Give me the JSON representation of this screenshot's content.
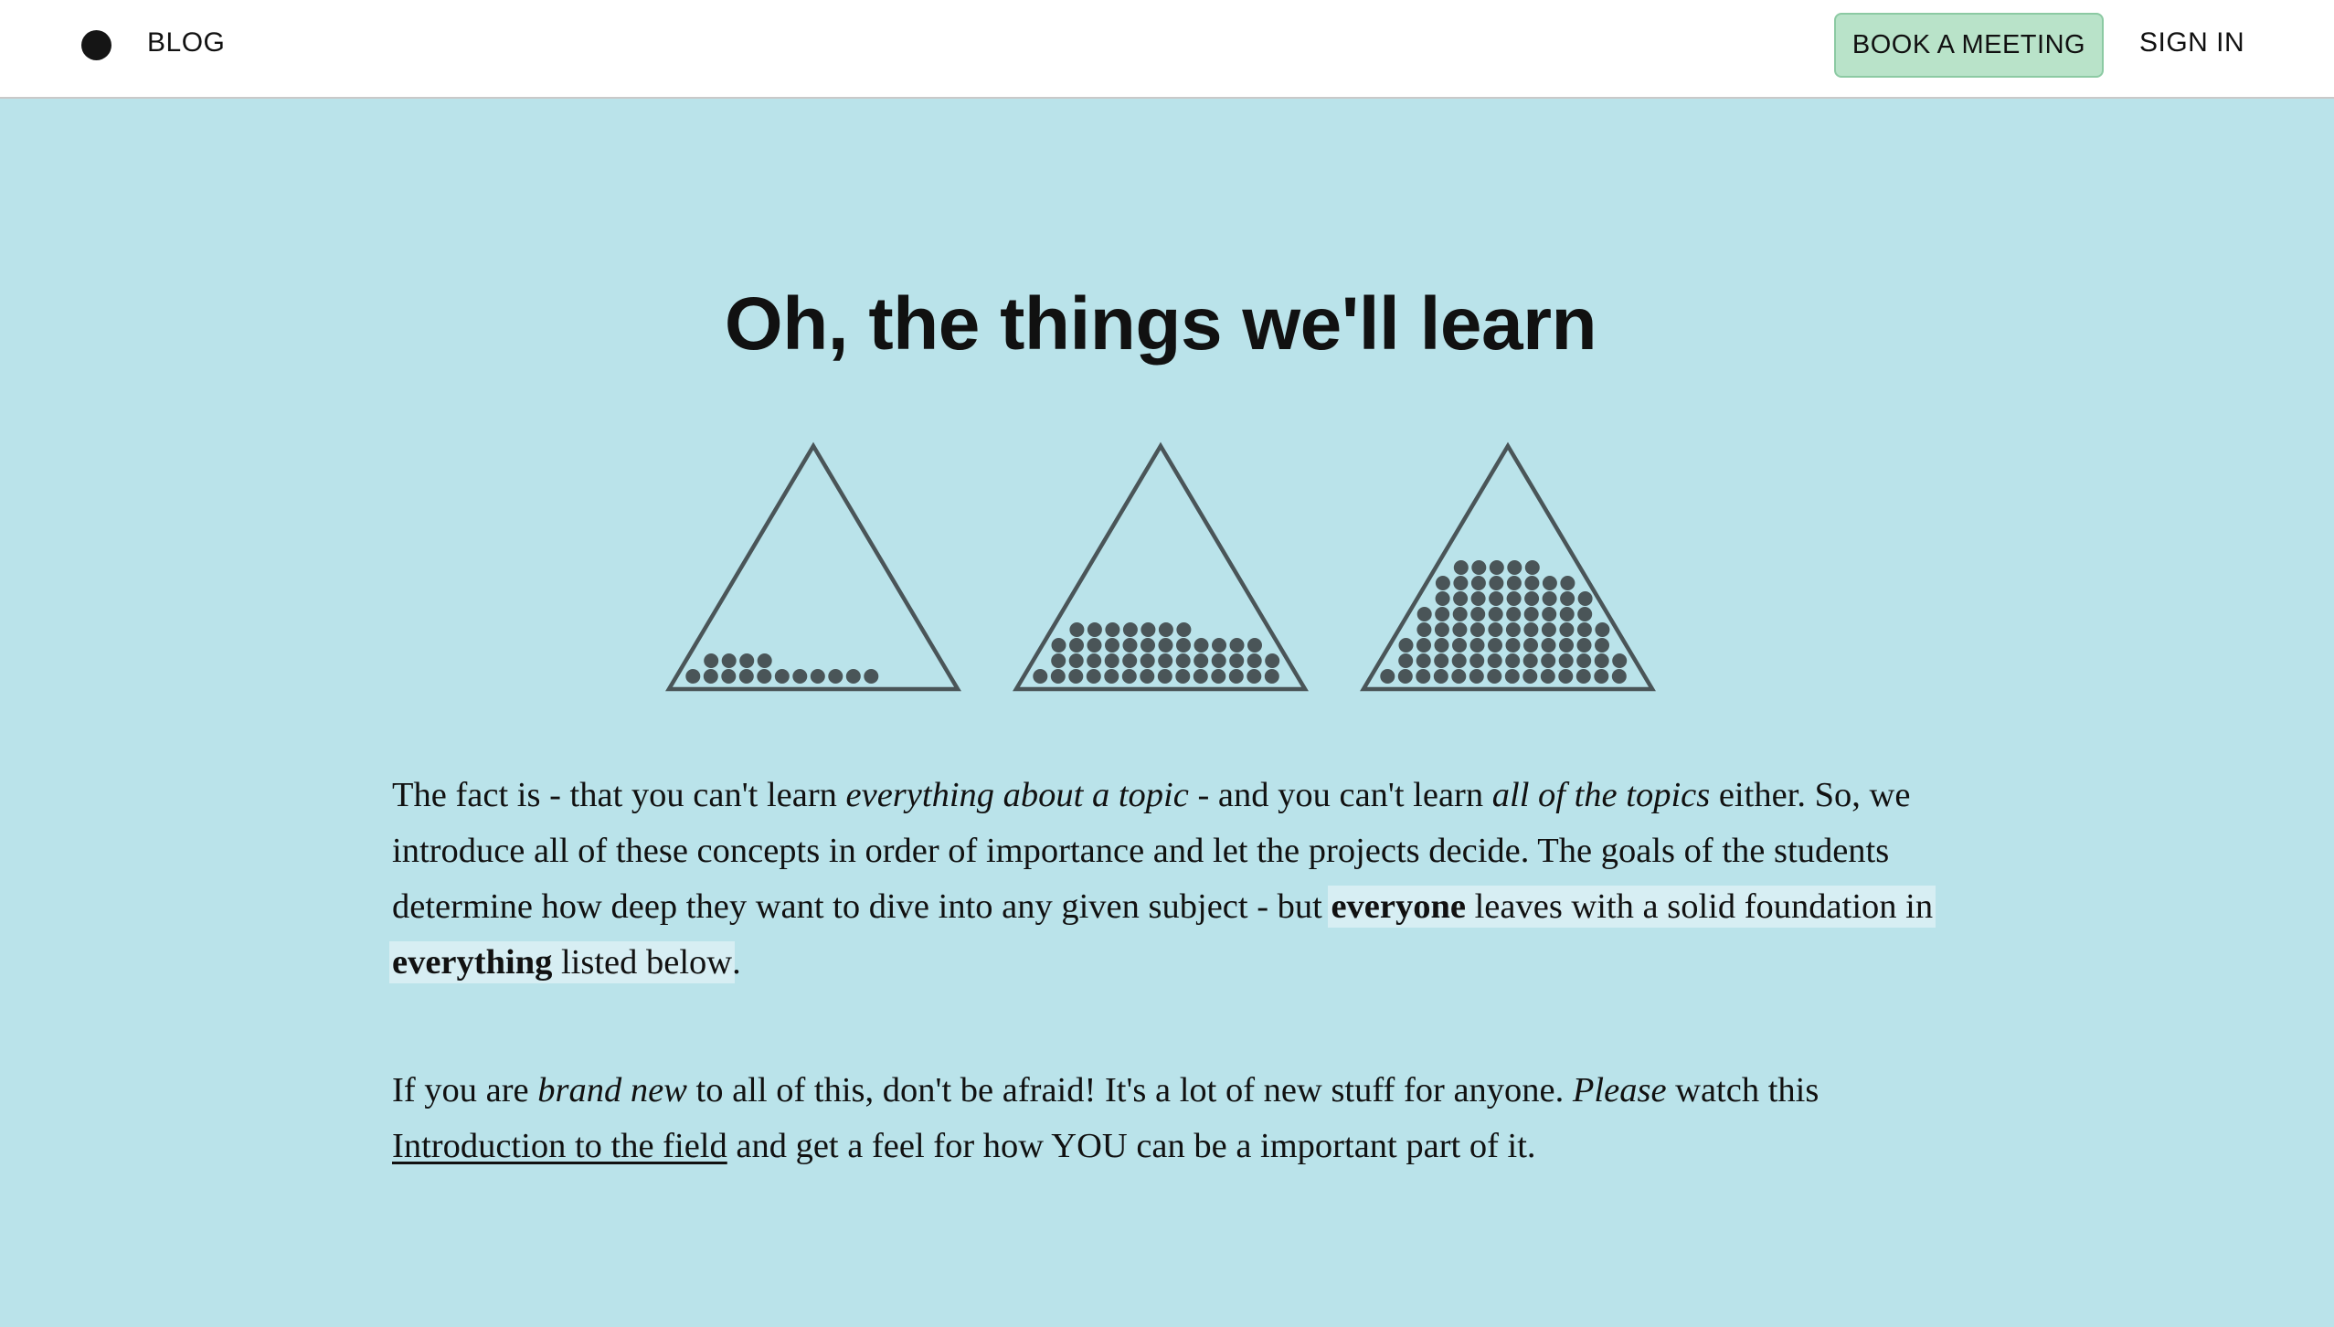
{
  "nav": {
    "blog_label": "BLOG",
    "book_label": "BOOK A MEETING",
    "signin_label": "SIGN IN"
  },
  "hero": {
    "title": "Oh, the things we'll learn"
  },
  "illustration": {
    "icon": "triangle-dot-fill-icons",
    "stroke_color": "#4a5558",
    "fill_levels": [
      {
        "rows": [
          11,
          4
        ]
      },
      {
        "rows": [
          14,
          13,
          14,
          7
        ]
      },
      {
        "rows": [
          15,
          14,
          13,
          12,
          11,
          10,
          8,
          5
        ]
      }
    ]
  },
  "paragraph1": {
    "t1": "The fact is - that you can't learn ",
    "em1": "everything about a topic",
    "t2": " - and you can't learn ",
    "em2": "all of the topics",
    "t3": " either. So, we introduce all of these concepts in order of importance and let the projects decide. The goals of the students determine how deep they want to dive into any given subject - but ",
    "hl_b1": "everyone",
    "hl_t1": " leaves with a solid foundation in ",
    "hl_b2": "everything",
    "hl_t2": " listed below",
    "t4": "."
  },
  "paragraph2": {
    "t1": "If you are ",
    "em1": "brand new",
    "t2": " to all of this, don't be afraid! It's a lot of new stuff for anyone. ",
    "em2": "Please",
    "t3": " watch this ",
    "link": "Introduction to the field",
    "t4": " and get a feel for how YOU can be a important part of it."
  },
  "colors": {
    "background": "#bae3ea",
    "header": "#ffffff",
    "button_fill": "#b9e3c9",
    "button_border": "#8ccaa3",
    "highlight": "#d7eef3"
  }
}
